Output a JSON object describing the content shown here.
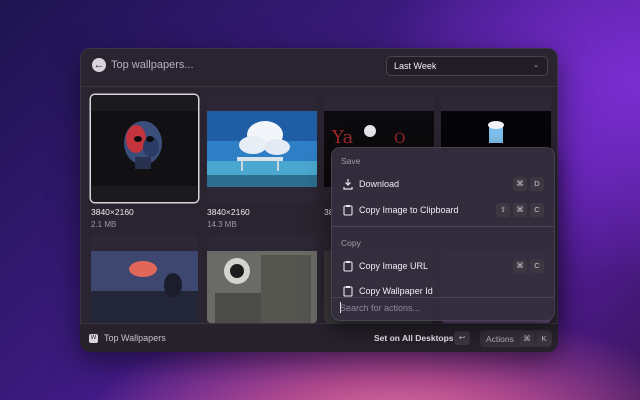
{
  "header": {
    "title": "Top wallpapers...",
    "filter": {
      "selected": "Last Week"
    }
  },
  "grid": {
    "items": [
      {
        "resolution": "3840×2160",
        "size": "2.1 MB"
      },
      {
        "resolution": "3840×2160",
        "size": "14.3 MB"
      },
      {
        "resolution": "38",
        "size": ""
      },
      {
        "resolution": "",
        "size": ""
      },
      {
        "resolution": "",
        "size": ""
      },
      {
        "resolution": "",
        "size": ""
      },
      {
        "resolution": "",
        "size": ""
      },
      {
        "resolution": "",
        "size": ""
      }
    ]
  },
  "menu": {
    "sections": [
      {
        "title": "Save",
        "items": [
          {
            "label": "Download",
            "icon": "download-icon",
            "shortcut": [
              "⌘",
              "D"
            ]
          },
          {
            "label": "Copy Image to Clipboard",
            "icon": "clipboard-icon",
            "shortcut": [
              "⇧",
              "⌘",
              "C"
            ]
          }
        ]
      },
      {
        "title": "Copy",
        "items": [
          {
            "label": "Copy Image URL",
            "icon": "clipboard-icon",
            "shortcut": [
              "⌘",
              "C"
            ]
          },
          {
            "label": "Copy Wallpaper Id",
            "icon": "clipboard-icon",
            "shortcut": []
          }
        ]
      }
    ],
    "search_placeholder": "Search for actions..."
  },
  "footer": {
    "title": "Top Wallpapers",
    "primary_action": "Set on All Desktops",
    "primary_key": "↩",
    "actions_label": "Actions",
    "actions_keys": [
      "⌘",
      "K"
    ]
  }
}
